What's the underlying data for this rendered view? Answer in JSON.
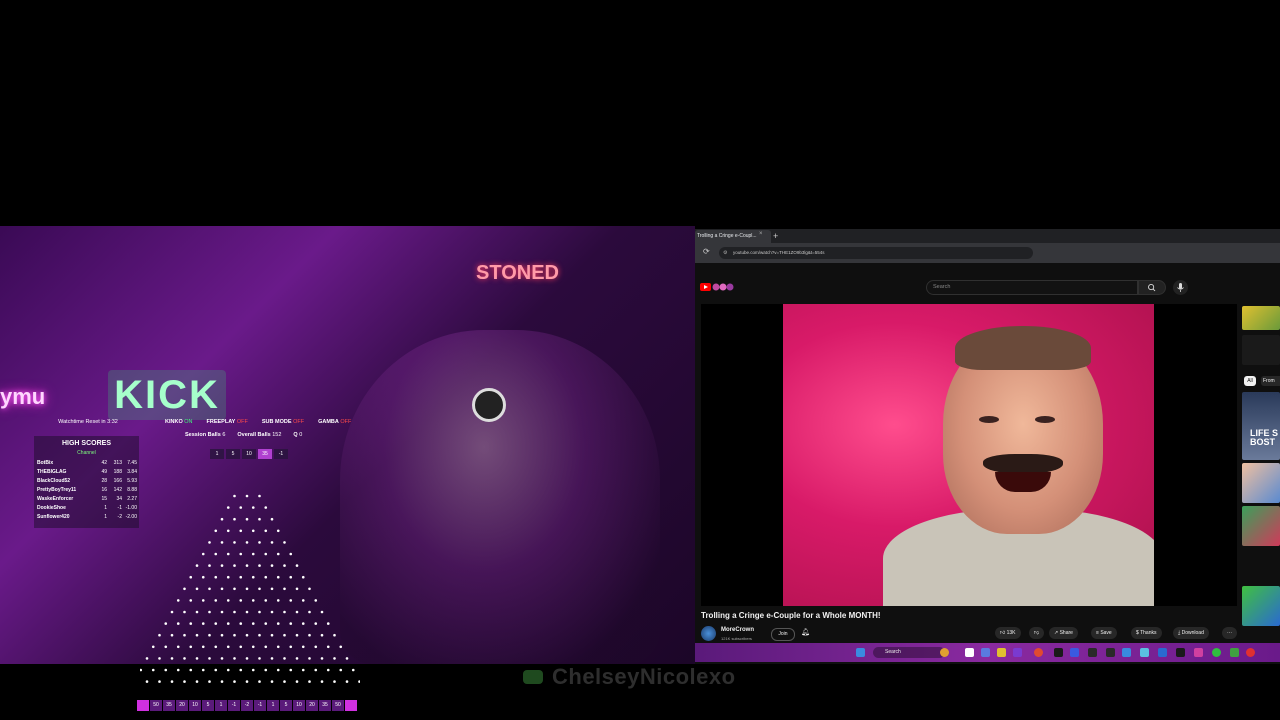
{
  "stream_overlay": {
    "neon_sign_left": "ymu",
    "kick_sign": "KICK",
    "stoned_sign": "STONED",
    "watchtime": "Watchtime Reset in 3:32",
    "high_scores": {
      "title": "HIGH SCORES",
      "subtitle": "Channel",
      "rows": [
        {
          "name": "BotBix",
          "a": "42",
          "b": "313",
          "c": "7.45"
        },
        {
          "name": "THEBIGLAG",
          "a": "49",
          "b": "188",
          "c": "3.84"
        },
        {
          "name": "BlackCloud52",
          "a": "28",
          "b": "166",
          "c": "5.93"
        },
        {
          "name": "PrettyBoyTrey11",
          "a": "16",
          "b": "142",
          "c": "8.88"
        },
        {
          "name": "WaskeEnforcer",
          "a": "15",
          "b": "34",
          "c": "2.27"
        },
        {
          "name": "DookieShoe",
          "a": "1",
          "b": "-1",
          "c": "-1.00"
        },
        {
          "name": "Sunflower420",
          "a": "1",
          "b": "-2",
          "c": "-2.00"
        }
      ]
    },
    "status": [
      {
        "label": "KINKO",
        "state": "ON"
      },
      {
        "label": "FREEPLAY",
        "state": "OFF"
      },
      {
        "label": "SUB MODE",
        "state": "OFF"
      },
      {
        "label": "GAMBA",
        "state": "OFF"
      }
    ],
    "session": {
      "session_balls_label": "Session Balls",
      "session_balls": "6",
      "overall_balls_label": "Overall Balls",
      "overall_balls": "152",
      "q_label": "Q",
      "q": "0"
    },
    "bet_chips": [
      "1",
      "5",
      "10",
      "35",
      "-1"
    ],
    "bottom_chips": [
      "50",
      "35",
      "20",
      "10",
      "5",
      "1",
      "-1",
      "-2",
      "-1",
      "1",
      "5",
      "10",
      "20",
      "35",
      "50"
    ],
    "channel_name": "ChelseyNicolexo"
  },
  "browser": {
    "tab_title": "Trolling a Cringe e-Coupl...",
    "new_tab": "+",
    "url": "youtube.com/watch?v=THE1ZO9b3lg&t=554s",
    "search_placeholder": "Search",
    "video_title": "Trolling a Cringe e-Couple for a Whole MONTH!",
    "channel": "MoreCrown",
    "subscribers": "121K subscribers",
    "join": "Join",
    "likes": "13K",
    "share": "Share",
    "save": "Save",
    "thanks": "Thanks",
    "download": "Download",
    "more": "···",
    "chip_all": "All",
    "chip_from": "From",
    "thumb_text": "LIFE S BOST",
    "taskbar_search": "Search"
  },
  "colors": {
    "neon_pink": "#ff2bd6",
    "youtube_red": "#ff0000",
    "taskbar": "#8a2aa0"
  }
}
